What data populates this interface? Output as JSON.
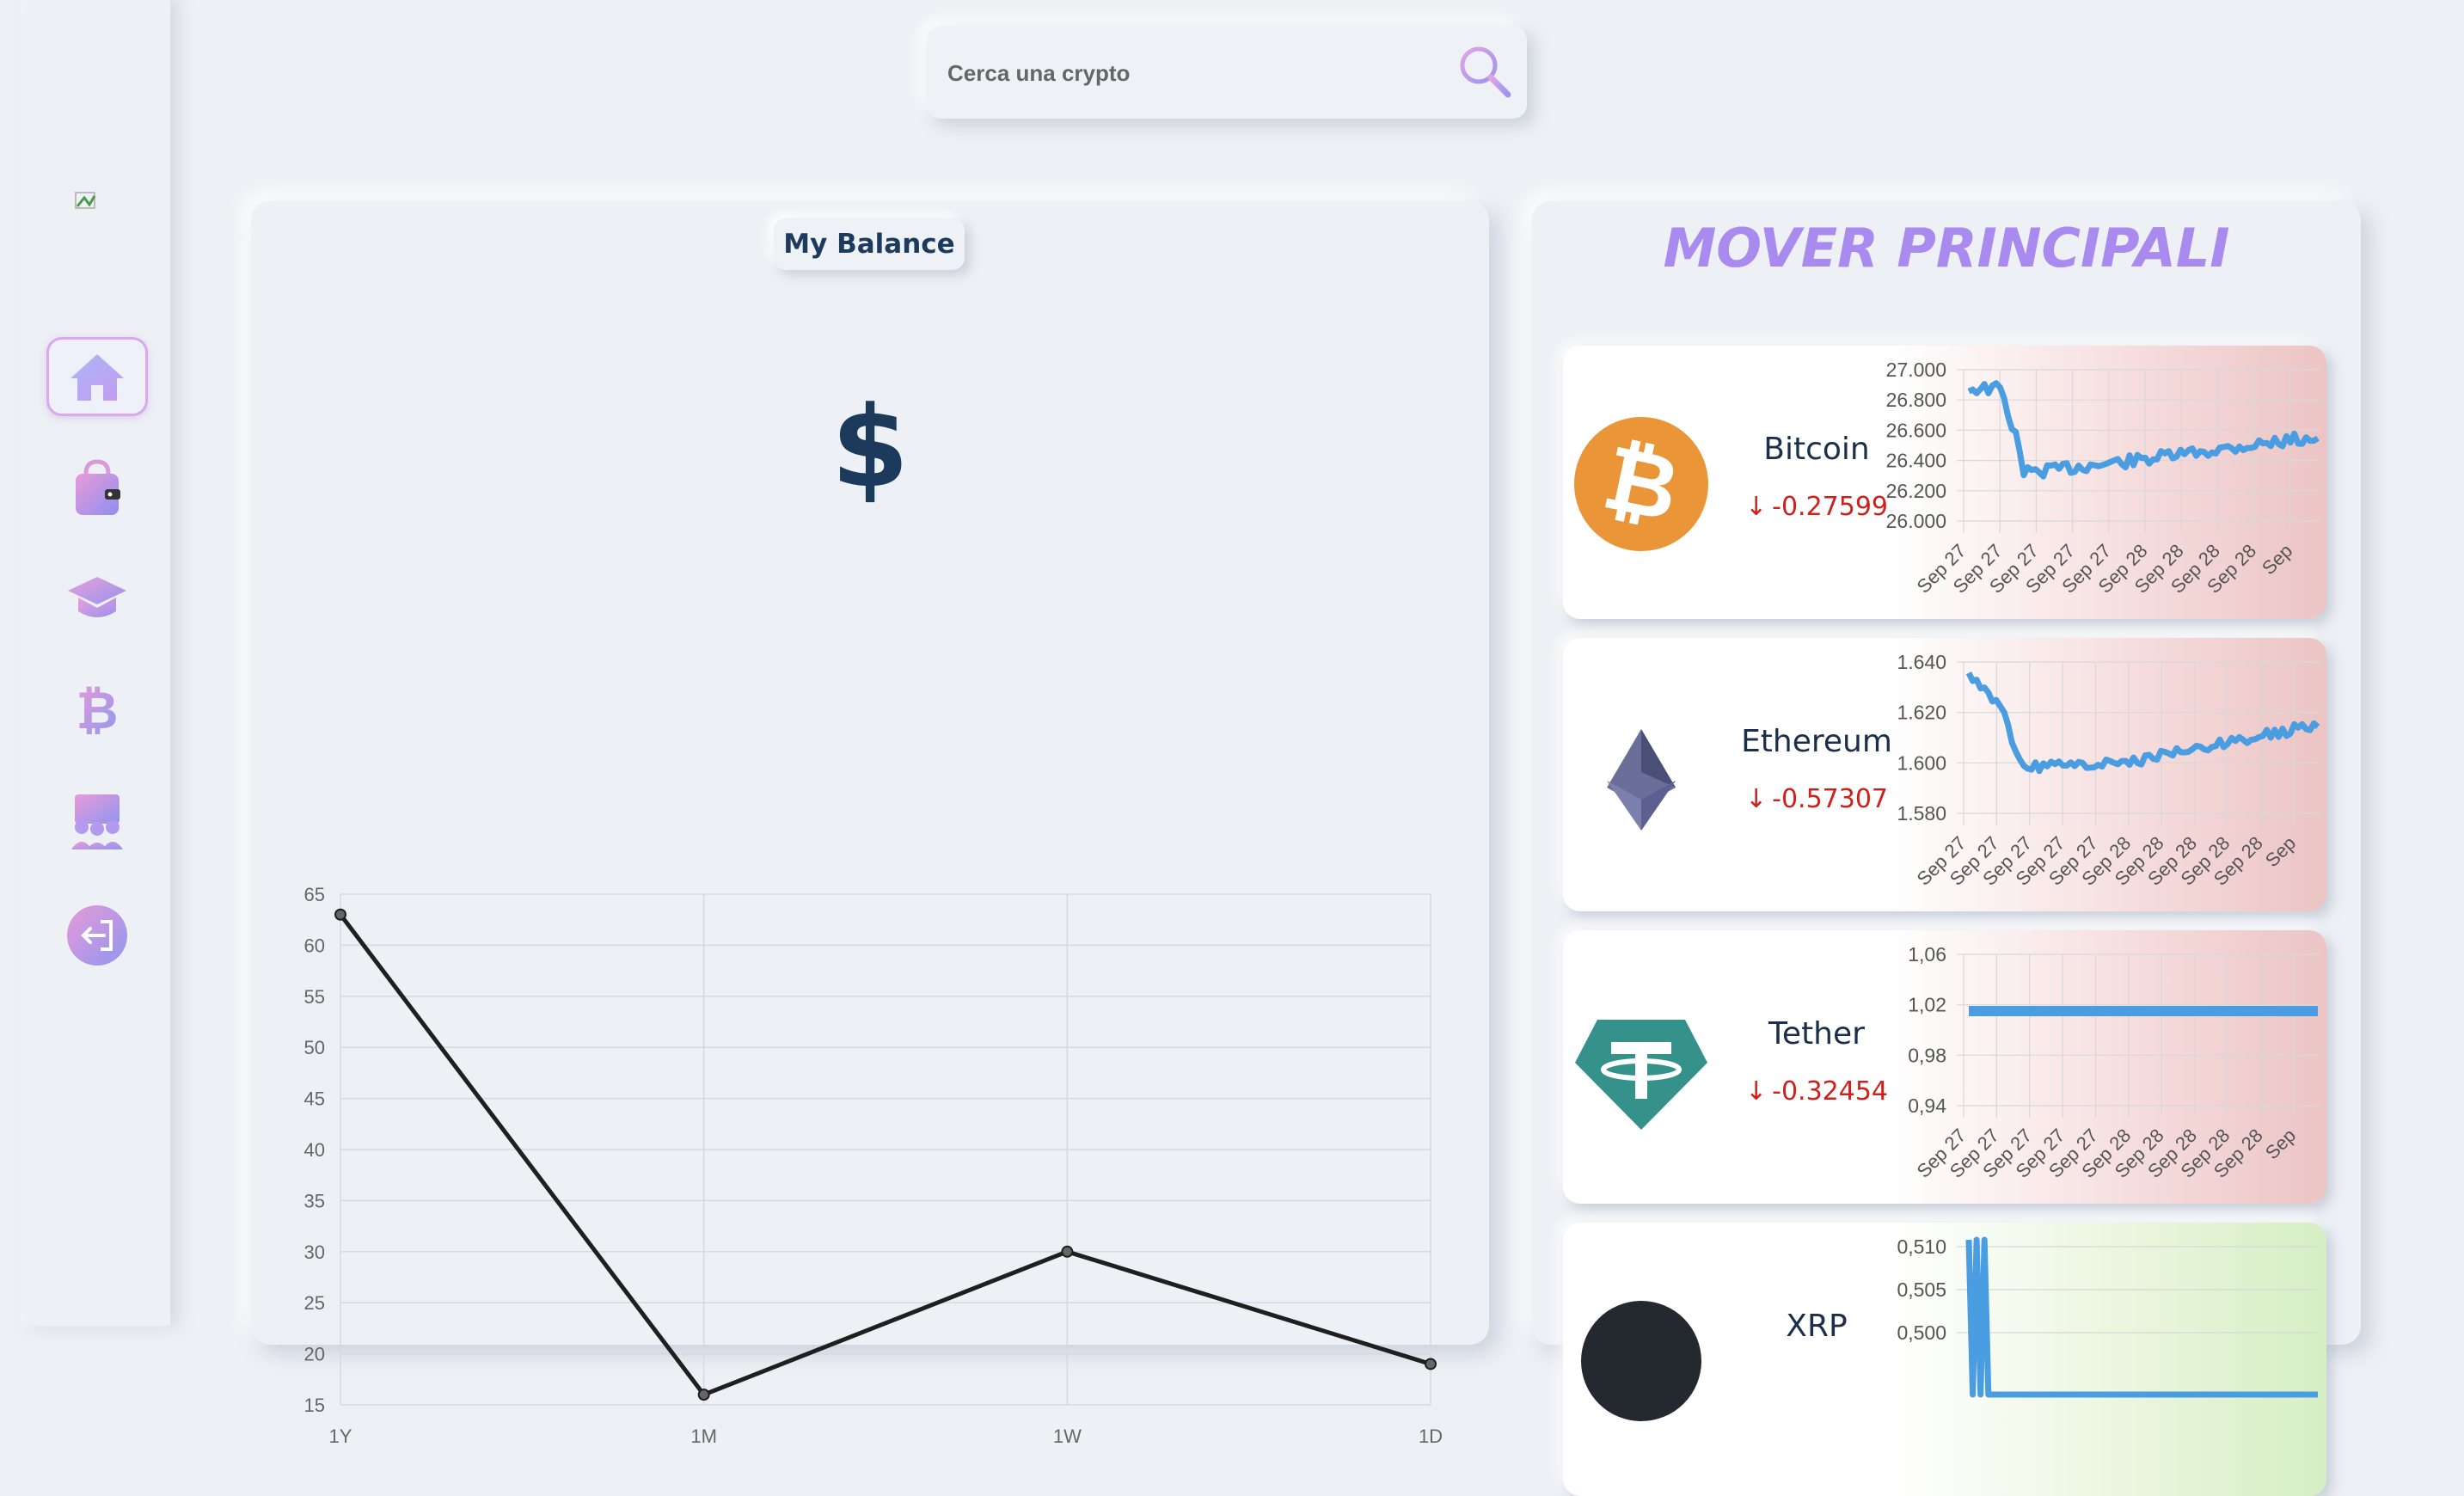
{
  "search": {
    "placeholder": "Cerca una crypto"
  },
  "nav": {
    "items": [
      {
        "name": "home-icon",
        "active": true
      },
      {
        "name": "wallet-icon",
        "active": false
      },
      {
        "name": "graduation-cap-icon",
        "active": false
      },
      {
        "name": "bitcoin-icon",
        "active": false
      },
      {
        "name": "community-icon",
        "active": false
      },
      {
        "name": "logout-icon",
        "active": false
      }
    ]
  },
  "balance": {
    "title": "My Balance",
    "currency_symbol": "$"
  },
  "chart_data": {
    "type": "line",
    "categories": [
      "1Y",
      "1M",
      "1W",
      "1D"
    ],
    "values": [
      63,
      16,
      30,
      19
    ],
    "ylim": [
      15,
      65
    ],
    "yticks": [
      65,
      60,
      55,
      50,
      45,
      40,
      35,
      30,
      25,
      20,
      15
    ],
    "grid": true,
    "title": "",
    "xlabel": "",
    "ylabel": ""
  },
  "movers": {
    "title": "MOVER PRINCIPALI",
    "coins": [
      {
        "name": "Bitcoin",
        "change": "-0.27599",
        "logo": "bitcoin-logo",
        "trend": "down",
        "color": "#f7931a",
        "y_ticks": [
          "27.000",
          "26.800",
          "26.600",
          "26.400",
          "26.200",
          "26.000"
        ],
        "x_ticks": [
          "Sep 27",
          "Sep 27",
          "Sep 27",
          "Sep 27",
          "Sep 27",
          "Sep 28",
          "Sep 28",
          "Sep 28",
          "Sep 28",
          "Sep"
        ]
      },
      {
        "name": "Ethereum",
        "change": "-0.57307",
        "logo": "ethereum-logo",
        "trend": "down",
        "color": "#627eea",
        "y_ticks": [
          "1.640",
          "1.620",
          "1.600",
          "1.580"
        ],
        "x_ticks": [
          "Sep 27",
          "Sep 27",
          "Sep 27",
          "Sep 27",
          "Sep 27",
          "Sep 28",
          "Sep 28",
          "Sep 28",
          "Sep 28",
          "Sep 28",
          "Sep"
        ]
      },
      {
        "name": "Tether",
        "change": "-0.32454",
        "logo": "tether-logo",
        "trend": "down",
        "color": "#26a17b",
        "y_ticks": [
          "1,06",
          "1,02",
          "0,98",
          "0,94"
        ],
        "x_ticks": [
          "Sep 27",
          "Sep 27",
          "Sep 27",
          "Sep 27",
          "Sep 27",
          "Sep 28",
          "Sep 28",
          "Sep 28",
          "Sep 28",
          "Sep 28",
          "Sep"
        ]
      },
      {
        "name": "XRP",
        "change": "",
        "logo": "xrp-logo",
        "trend": "up",
        "color": "#23292f",
        "y_ticks": [
          "0,510",
          "0,505",
          "0,500"
        ],
        "x_ticks": []
      }
    ]
  }
}
